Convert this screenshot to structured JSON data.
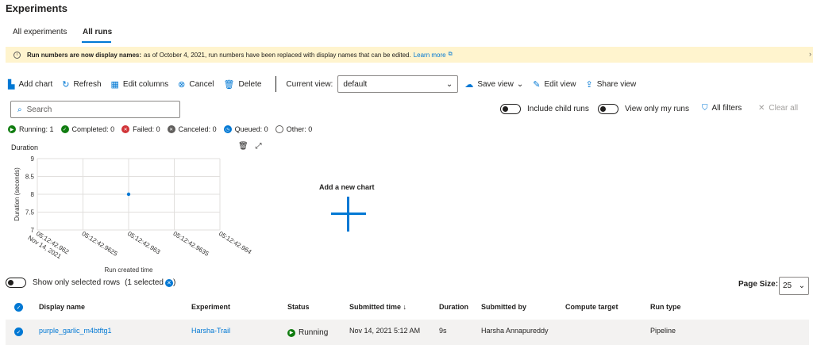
{
  "page": {
    "title": "Experiments"
  },
  "tabs": [
    {
      "label": "All experiments"
    },
    {
      "label": "All runs"
    }
  ],
  "banner": {
    "bold": "Run numbers are now display names:",
    "text": "as of October 4, 2021, run numbers have been replaced with display names that can be edited.",
    "link": "Learn more"
  },
  "toolbar": {
    "add_chart": "Add chart",
    "refresh": "Refresh",
    "edit_columns": "Edit columns",
    "cancel": "Cancel",
    "delete": "Delete",
    "current_view_label": "Current view:",
    "current_view_value": "default",
    "save_view": "Save view",
    "edit_view": "Edit view",
    "share_view": "Share view"
  },
  "search": {
    "placeholder": "Search"
  },
  "filters": {
    "include_child_runs": "Include child runs",
    "view_only_my_runs": "View only my runs",
    "all_filters": "All filters",
    "clear_all": "Clear all"
  },
  "status_counts": [
    {
      "label": "Running: 1",
      "color": "#107c10"
    },
    {
      "label": "Completed: 0",
      "color": "#107c10"
    },
    {
      "label": "Failed: 0",
      "color": "#d13438"
    },
    {
      "label": "Canceled: 0",
      "color": "#605e5c"
    },
    {
      "label": "Queued: 0",
      "color": "#0078d4"
    },
    {
      "label": "Other: 0",
      "color": "#ffffff"
    }
  ],
  "chart_panel": {
    "title": "Duration",
    "add_new_chart": "Add a new chart"
  },
  "chart_data": {
    "type": "scatter",
    "title": "Duration",
    "xlabel": "Run created time",
    "ylabel": "Duration (seconds)",
    "y_ticks": [
      "9",
      "8.5",
      "8",
      "7.5",
      "7"
    ],
    "ylim": [
      7,
      9
    ],
    "x_ticks": [
      "05:12:42.962\nNov 14, 2021",
      "05:12:42.9625",
      "05:12:42.963",
      "05:12:42.9635",
      "05:12:42.964"
    ],
    "points": [
      {
        "x": "05:12:42.963",
        "y": 8
      }
    ],
    "grid": true,
    "color": "#0078d4"
  },
  "selection": {
    "show_only_selected": "Show only selected rows",
    "selected_count": "(1 selected",
    "selected_close": ")"
  },
  "pagination": {
    "label": "Page Size:",
    "value": "25"
  },
  "table": {
    "columns": [
      "Display name",
      "Experiment",
      "Status",
      "Submitted time ↓",
      "Duration",
      "Submitted by",
      "Compute target",
      "Run type"
    ],
    "rows": [
      {
        "display_name": "purple_garlic_m4btftg1",
        "experiment": "Harsha-Trail",
        "status": "Running",
        "submitted_time": "Nov 14, 2021 5:12 AM",
        "duration": "9s",
        "submitted_by": "Harsha Annapureddy",
        "compute_target": "",
        "run_type": "Pipeline"
      }
    ]
  }
}
